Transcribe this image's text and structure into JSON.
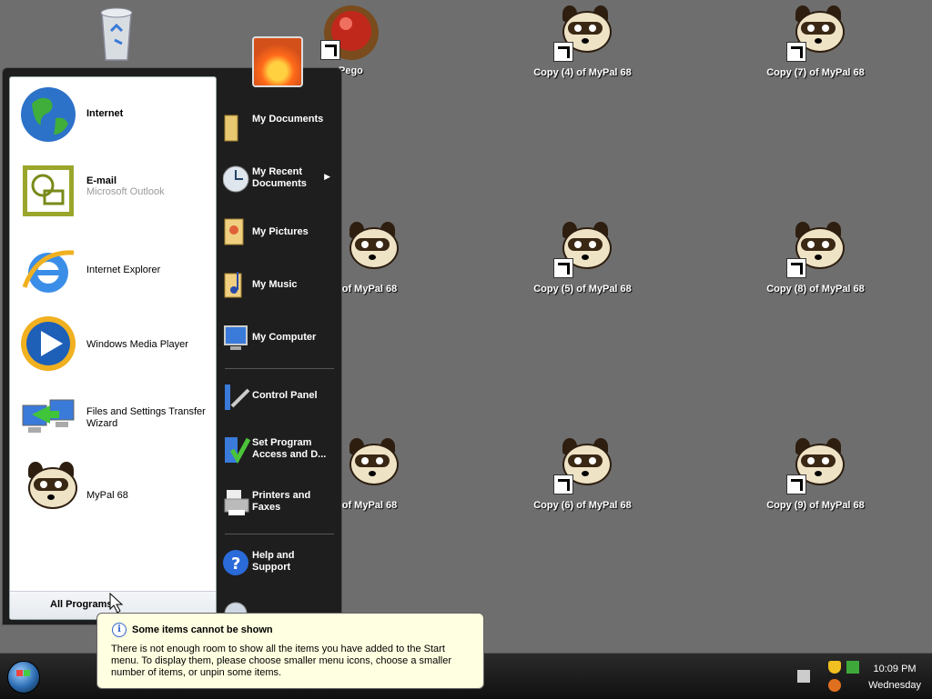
{
  "desktop": {
    "icons": [
      {
        "label": "",
        "kind": "recycle-bin"
      },
      {
        "label": "Pego",
        "kind": "red-ball"
      },
      {
        "label": "Copy (4) of MyPal 68",
        "kind": "raccoon"
      },
      {
        "label": "Copy (7) of MyPal 68",
        "kind": "raccoon"
      },
      {
        "label": "of MyPal 68",
        "kind": "raccoon"
      },
      {
        "label": "Copy (5) of MyPal 68",
        "kind": "raccoon"
      },
      {
        "label": "Copy (8) of MyPal 68",
        "kind": "raccoon"
      },
      {
        "label": "of MyPal 68",
        "kind": "raccoon"
      },
      {
        "label": "Copy (6) of MyPal 68",
        "kind": "raccoon"
      },
      {
        "label": "Copy (9) of MyPal 68",
        "kind": "raccoon"
      }
    ]
  },
  "start_menu": {
    "pinned": [
      {
        "label": "Internet",
        "sub": "",
        "icon": "globe-icon"
      },
      {
        "label": "E-mail",
        "sub": "Microsoft Outlook",
        "icon": "outlook-icon"
      }
    ],
    "recent": [
      {
        "label": "Internet Explorer",
        "icon": "ie-icon"
      },
      {
        "label": "Windows Media Player",
        "icon": "media-player-icon"
      },
      {
        "label": "Files and Settings Transfer Wizard",
        "icon": "transfer-wizard-icon"
      },
      {
        "label": "MyPal 68",
        "icon": "raccoon-icon"
      }
    ],
    "all_programs": "All Programs",
    "right": [
      {
        "label": "My Documents",
        "icon": "folder-icon"
      },
      {
        "label": "My Recent Documents",
        "icon": "clock-icon",
        "submenu": true
      },
      {
        "label": "My Pictures",
        "icon": "pictures-icon"
      },
      {
        "label": "My Music",
        "icon": "music-icon"
      },
      {
        "label": "My Computer",
        "icon": "computer-icon"
      },
      {
        "label": "Control Panel",
        "icon": "control-panel-icon"
      },
      {
        "label": "Set Program Access and D...",
        "icon": "set-program-icon"
      },
      {
        "label": "Printers and Faxes",
        "icon": "printer-icon"
      },
      {
        "label": "Help and Support",
        "icon": "help-icon"
      }
    ]
  },
  "balloon": {
    "title": "Some items cannot be shown",
    "body": "There is not enough room to show all the items you have added to the Start menu.  To display them, please choose smaller menu icons, choose a smaller number of items, or unpin some items."
  },
  "taskbar": {
    "time": "10:09 PM",
    "day": "Wednesday"
  }
}
